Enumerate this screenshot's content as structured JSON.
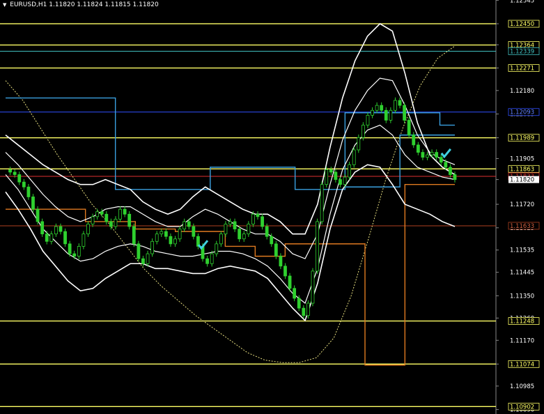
{
  "chart_data": {
    "type": "candlestick",
    "header": {
      "symbol": "EURUSD,H1",
      "ohlc": "1.11820 1.11824 1.11815 1.11820"
    },
    "ylim": [
      1.10872,
      1.12546
    ],
    "y_ticks": [
      "1.12545",
      "1.12450",
      "1.12365",
      "1.12271",
      "1.12180",
      "1.12085",
      "1.11989",
      "1.11905",
      "1.11820",
      "1.11720",
      "1.11625",
      "1.11535",
      "1.11445",
      "1.11350",
      "1.11260",
      "1.11170",
      "1.11074",
      "1.10985",
      "1.10890"
    ],
    "horizontal_levels": [
      {
        "value": 1.1245,
        "label": "1.12450",
        "color": "#ffff66"
      },
      {
        "value": 1.12364,
        "label": "1.12364",
        "color": "#ffff66"
      },
      {
        "value": 1.12339,
        "label": "1.12339",
        "color": "#40c0c0"
      },
      {
        "value": 1.12271,
        "label": "1.12271",
        "color": "#ffff66"
      },
      {
        "value": 1.12093,
        "label": "1.12093",
        "color": "#3050ff"
      },
      {
        "value": 1.11989,
        "label": "1.11989",
        "color": "#ffff66"
      },
      {
        "value": 1.11863,
        "label": "1.11863",
        "color": "#ffff66"
      },
      {
        "value": 1.11833,
        "label": "1.11833",
        "color": "#e03030"
      },
      {
        "value": 1.11633,
        "label": "1.11633",
        "color": "#b04020"
      },
      {
        "value": 1.11248,
        "label": "1.11248",
        "color": "#ffff66"
      },
      {
        "value": 1.11074,
        "label": "1.11074",
        "color": "#ffff66"
      },
      {
        "value": 1.10902,
        "label": "1.10902",
        "color": "#ffff66"
      }
    ],
    "current_price": {
      "value": 1.1182,
      "label": "1.11820"
    },
    "candle_path": [
      1.1186,
      1.1185,
      1.1184,
      1.1181,
      1.1179,
      1.1175,
      1.117,
      1.1165,
      1.116,
      1.1157,
      1.116,
      1.1163,
      1.1161,
      1.1156,
      1.1152,
      1.1151,
      1.1155,
      1.116,
      1.1164,
      1.1167,
      1.1169,
      1.1168,
      1.1165,
      1.1163,
      1.1166,
      1.117,
      1.1168,
      1.1163,
      1.1156,
      1.115,
      1.1148,
      1.1152,
      1.1157,
      1.116,
      1.1161,
      1.1159,
      1.1156,
      1.1158,
      1.1162,
      1.1165,
      1.1163,
      1.1159,
      1.1155,
      1.115,
      1.1148,
      1.1152,
      1.1156,
      1.116,
      1.1164,
      1.1165,
      1.1162,
      1.1158,
      1.116,
      1.1164,
      1.1168,
      1.1167,
      1.1163,
      1.1159,
      1.1156,
      1.1151,
      1.1147,
      1.1143,
      1.1138,
      1.1134,
      1.113,
      1.1127,
      1.1132,
      1.1145,
      1.1165,
      1.118,
      1.1186,
      1.1185,
      1.1182,
      1.118,
      1.1183,
      1.1188,
      1.1194,
      1.1199,
      1.1204,
      1.1208,
      1.121,
      1.1212,
      1.121,
      1.1206,
      1.121,
      1.1214,
      1.1212,
      1.1206,
      1.12,
      1.1196,
      1.1193,
      1.1191,
      1.1192,
      1.1193,
      1.1191,
      1.1189,
      1.1187,
      1.1184,
      1.1182
    ],
    "bands": {
      "outer_upper": [
        1.12,
        1.1196,
        1.1192,
        1.1188,
        1.1185,
        1.1182,
        1.118,
        1.118,
        1.1182,
        1.118,
        1.1178,
        1.1173,
        1.117,
        1.1168,
        1.117,
        1.1175,
        1.1179,
        1.1176,
        1.1173,
        1.117,
        1.1168,
        1.1168,
        1.1165,
        1.116,
        1.116,
        1.1172,
        1.1195,
        1.1215,
        1.123,
        1.124,
        1.1245,
        1.1242,
        1.1225,
        1.1205,
        1.1192,
        1.1187,
        1.1184
      ],
      "outer_lower": [
        1.1177,
        1.117,
        1.1162,
        1.1153,
        1.1147,
        1.1141,
        1.1137,
        1.1138,
        1.1142,
        1.1145,
        1.1148,
        1.1148,
        1.1146,
        1.1146,
        1.1145,
        1.1144,
        1.1144,
        1.1146,
        1.1147,
        1.1146,
        1.1145,
        1.1142,
        1.1136,
        1.113,
        1.1125,
        1.114,
        1.1162,
        1.1178,
        1.1185,
        1.1188,
        1.1187,
        1.118,
        1.1172,
        1.117,
        1.1168,
        1.1165,
        1.1163
      ],
      "inner_upper": [
        1.1193,
        1.1188,
        1.1182,
        1.1176,
        1.1171,
        1.1167,
        1.1165,
        1.1167,
        1.117,
        1.1171,
        1.1171,
        1.1168,
        1.1165,
        1.1163,
        1.1163,
        1.1167,
        1.117,
        1.1168,
        1.1165,
        1.1162,
        1.116,
        1.116,
        1.1157,
        1.1152,
        1.115,
        1.116,
        1.118,
        1.1198,
        1.121,
        1.1218,
        1.1223,
        1.1222,
        1.1212,
        1.12,
        1.1193,
        1.119,
        1.1188
      ],
      "inner_lower": [
        1.1184,
        1.1178,
        1.117,
        1.1162,
        1.1157,
        1.1152,
        1.1149,
        1.115,
        1.1153,
        1.1155,
        1.1156,
        1.1155,
        1.1153,
        1.1152,
        1.1151,
        1.1151,
        1.1152,
        1.1153,
        1.1153,
        1.1152,
        1.115,
        1.1147,
        1.1142,
        1.1136,
        1.1132,
        1.1146,
        1.1168,
        1.1186,
        1.1196,
        1.1202,
        1.1204,
        1.12,
        1.1192,
        1.1187,
        1.1185,
        1.1183,
        1.1182
      ]
    },
    "blue_channel": {
      "upper": [
        [
          0,
          1.1215
        ],
        [
          22,
          1.1215
        ],
        [
          22,
          1.1178
        ],
        [
          41,
          1.1178
        ],
        [
          41,
          1.1187
        ],
        [
          58,
          1.1187
        ],
        [
          58,
          1.1178
        ],
        [
          68,
          1.1178
        ],
        [
          68,
          1.1209
        ],
        [
          87,
          1.1209
        ],
        [
          87,
          1.1204
        ],
        [
          90,
          1.1204
        ]
      ],
      "lower": [
        [
          68,
          1.1179
        ],
        [
          79,
          1.1179
        ],
        [
          79,
          1.12
        ],
        [
          90,
          1.12
        ]
      ]
    },
    "orange_channel": [
      [
        0,
        1.117
      ],
      [
        16,
        1.117
      ],
      [
        16,
        1.1165
      ],
      [
        26,
        1.1165
      ],
      [
        26,
        1.1162
      ],
      [
        34,
        1.1162
      ],
      [
        34,
        1.1161
      ],
      [
        44,
        1.1161
      ],
      [
        44,
        1.1155
      ],
      [
        50,
        1.1155
      ],
      [
        50,
        1.1151
      ],
      [
        56,
        1.1151
      ],
      [
        56,
        1.1156
      ],
      [
        67,
        1.1156
      ],
      [
        67,
        1.1156
      ],
      [
        72,
        1.1156
      ],
      [
        72,
        1.1107
      ],
      [
        80,
        1.1107
      ],
      [
        80,
        1.118
      ],
      [
        90,
        1.118
      ]
    ],
    "dotted_ma": [
      1.1222,
      1.1214,
      1.1203,
      1.1192,
      1.1182,
      1.1172,
      1.1164,
      1.1155,
      1.1146,
      1.1139,
      1.1133,
      1.1127,
      1.1122,
      1.1117,
      1.1112,
      1.1109,
      1.1108,
      1.1108,
      1.111,
      1.1118,
      1.1135,
      1.1158,
      1.1182,
      1.1203,
      1.122,
      1.1231,
      1.1236
    ],
    "markers": [
      {
        "index": 43,
        "label": "check"
      },
      {
        "index": 96,
        "label": "check"
      }
    ]
  }
}
